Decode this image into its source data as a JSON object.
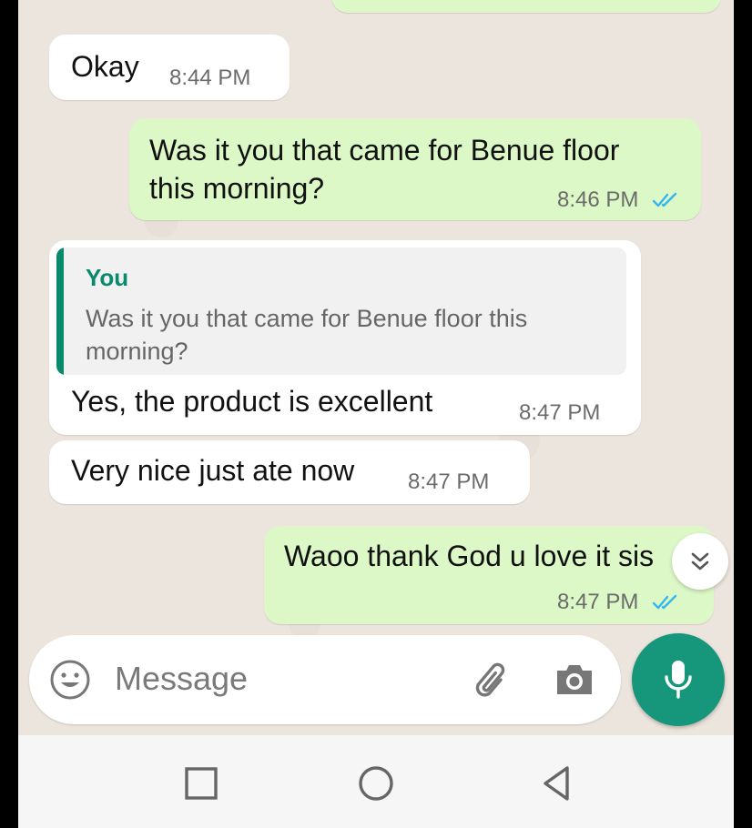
{
  "messages": [
    {
      "id": "partial",
      "direction": "out",
      "text": "",
      "time": ""
    },
    {
      "id": "m1",
      "direction": "in",
      "text": "Okay",
      "time": "8:44 PM"
    },
    {
      "id": "m2",
      "direction": "out",
      "lines": [
        "Was it you that came for Benue floor",
        "this morning?"
      ],
      "time": "8:46 PM",
      "status": "read"
    },
    {
      "id": "m3",
      "direction": "in",
      "quote": {
        "author": "You",
        "text": "Was it you that came for Benue floor this morning?"
      },
      "text": "Yes, the product is excellent",
      "time": "8:47 PM"
    },
    {
      "id": "m4",
      "direction": "in",
      "text": "Very nice just ate now",
      "time": "8:47 PM"
    },
    {
      "id": "m5",
      "direction": "out",
      "text": "Waoo thank God u love it sis",
      "time": "8:47 PM",
      "status": "read"
    }
  ],
  "composer": {
    "placeholder": "Message",
    "emoji_icon": "emoji-icon",
    "attach_icon": "paperclip-icon",
    "camera_icon": "camera-icon",
    "mic_icon": "microphone-icon"
  },
  "scroll_button_icon": "double-chevron-down-icon",
  "navbar": {
    "icons": [
      "square-recents-icon",
      "circle-home-icon",
      "triangle-back-icon"
    ]
  },
  "colors": {
    "incoming": "#ffffff",
    "outgoing": "#dcf8c6",
    "accent": "#16967b",
    "read_ticks": "#34b7f1",
    "chat_background": "#ece5dd"
  }
}
